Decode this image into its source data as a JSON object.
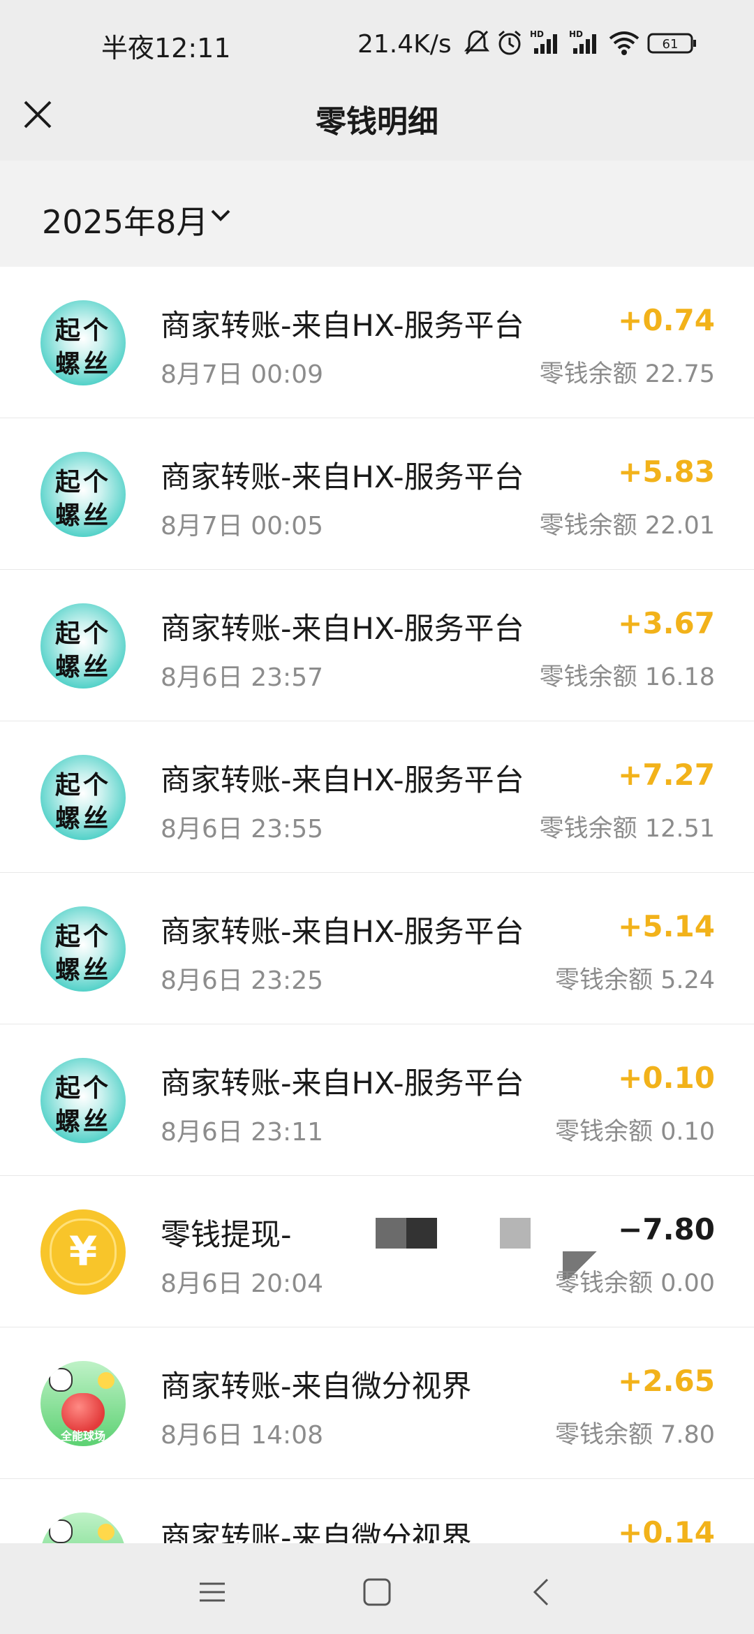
{
  "status_bar": {
    "time": "半夜12:11",
    "speed": "21.4K/s",
    "battery": "61",
    "icons": [
      "mute-icon",
      "alarm-icon",
      "hd-signal-icon",
      "hd-signal-icon",
      "wifi-icon",
      "battery-icon"
    ]
  },
  "header": {
    "title": "零钱明细",
    "close_icon": "close-icon"
  },
  "filter": {
    "month": "2025年8月",
    "chevron_icon": "chevron-down-icon"
  },
  "transactions": [
    {
      "title": "商家转账-来自HX-服务平台",
      "time": "8月7日 00:09",
      "amount": "+0.74",
      "balance": "零钱余额 22.75",
      "avatar": "screw"
    },
    {
      "title": "商家转账-来自HX-服务平台",
      "time": "8月7日 00:05",
      "amount": "+5.83",
      "balance": "零钱余额 22.01",
      "avatar": "screw"
    },
    {
      "title": "商家转账-来自HX-服务平台",
      "time": "8月6日 23:57",
      "amount": "+3.67",
      "balance": "零钱余额 16.18",
      "avatar": "screw"
    },
    {
      "title": "商家转账-来自HX-服务平台",
      "time": "8月6日 23:55",
      "amount": "+7.27",
      "balance": "零钱余额 12.51",
      "avatar": "screw"
    },
    {
      "title": "商家转账-来自HX-服务平台",
      "time": "8月6日 23:25",
      "amount": "+5.14",
      "balance": "零钱余额 5.24",
      "avatar": "screw"
    },
    {
      "title": "商家转账-来自HX-服务平台",
      "time": "8月6日 23:11",
      "amount": "+0.10",
      "balance": "零钱余额 0.10",
      "avatar": "screw"
    },
    {
      "title": "零钱提现-",
      "time": "8月6日 20:04",
      "amount": "−7.80",
      "balance": "零钱余额 0.00",
      "avatar": "coin"
    },
    {
      "title": "商家转账-来自微分视界",
      "time": "8月6日 14:08",
      "amount": "+2.65",
      "balance": "零钱余额 7.80",
      "avatar": "ball"
    },
    {
      "title": "商家转账-来自微分视界",
      "time": "",
      "amount": "+0.14",
      "balance": "",
      "avatar": "ball"
    }
  ],
  "avatar_text": {
    "screw_line1": "起个",
    "screw_line2": "螺丝",
    "coin_symbol": "¥",
    "ball_label": "全能球场"
  },
  "colors": {
    "income": "#f2b21a",
    "expense": "#1a1a1a",
    "header_bg": "#ededed"
  },
  "navbar": {
    "icons": [
      "menu-icon",
      "home-icon",
      "back-icon"
    ]
  }
}
